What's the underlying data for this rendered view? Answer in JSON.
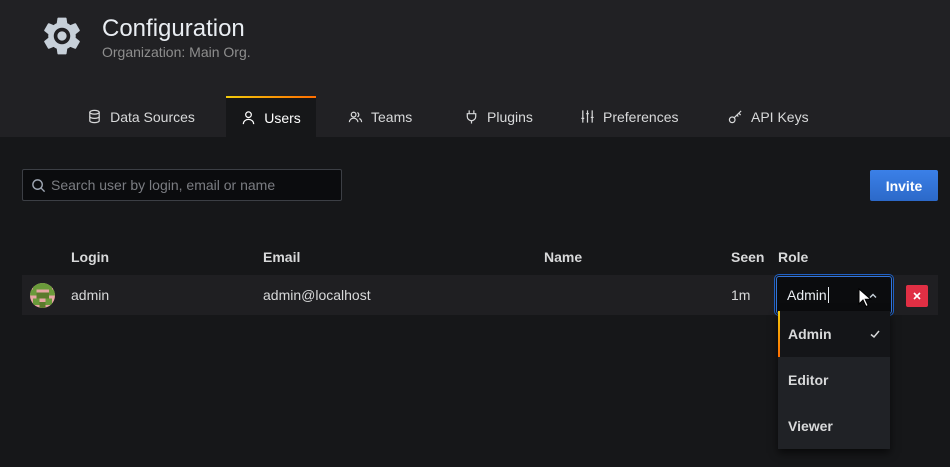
{
  "header": {
    "title": "Configuration",
    "subtitle": "Organization: Main Org."
  },
  "tabs": [
    {
      "label": "Data Sources",
      "icon": "database-icon",
      "active": false
    },
    {
      "label": "Users",
      "icon": "user-icon",
      "active": true
    },
    {
      "label": "Teams",
      "icon": "users-icon",
      "active": false
    },
    {
      "label": "Plugins",
      "icon": "plug-icon",
      "active": false
    },
    {
      "label": "Preferences",
      "icon": "sliders-icon",
      "active": false
    },
    {
      "label": "API Keys",
      "icon": "key-icon",
      "active": false
    }
  ],
  "search": {
    "placeholder": "Search user by login, email or name",
    "value": ""
  },
  "invite_label": "Invite",
  "table": {
    "headers": {
      "login": "Login",
      "email": "Email",
      "name": "Name",
      "seen": "Seen",
      "role": "Role"
    },
    "rows": [
      {
        "login": "admin",
        "email": "admin@localhost",
        "name": "",
        "seen": "1m",
        "role": "Admin"
      }
    ]
  },
  "role_dropdown": {
    "options": [
      "Admin",
      "Editor",
      "Viewer"
    ],
    "selected": "Admin"
  },
  "colors": {
    "accent": "#3274d9",
    "danger": "#e02f44",
    "active_tab_gradient_start": "#f2cc0c",
    "active_tab_gradient_end": "#ff6c00"
  }
}
